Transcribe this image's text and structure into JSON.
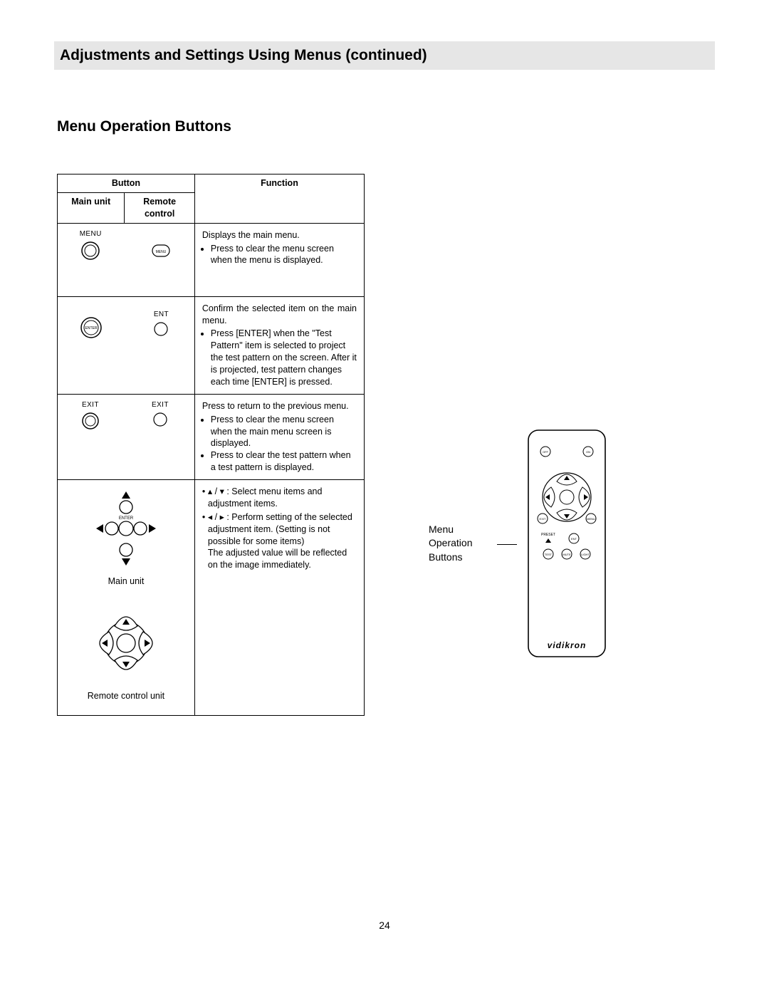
{
  "header": {
    "title": "Adjustments and Settings Using Menus (continued)"
  },
  "section_title": "Menu Operation Buttons",
  "page_number": "24",
  "table": {
    "button_header": "Button",
    "function_header": "Function",
    "main_unit_header": "Main unit",
    "remote_header": "Remote control",
    "rows": [
      {
        "main_label": "MENU",
        "remote_label": "MENU",
        "fn_main": "Displays the main menu.",
        "fn_bullets": [
          "Press to clear the menu screen when the menu is displayed."
        ]
      },
      {
        "main_label": "ENTER",
        "remote_label": "ENT",
        "fn_main": "Confirm the selected item on the main menu.",
        "fn_bullets": [
          "Press [ENTER] when the \"Test Pattern\" item is selected to project the test pattern on the screen. After it is projected, test pattern changes each time [ENTER] is pressed."
        ]
      },
      {
        "main_label": "EXIT",
        "remote_label": "EXIT",
        "fn_main": "Press to return to the previous menu.",
        "fn_bullets": [
          "Press to clear the menu screen when the main menu screen is displayed.",
          "Press to clear the test pattern when a test pattern is displayed."
        ]
      },
      {
        "arrows_label_main": "Main unit",
        "arrows_label_remote": "Remote control unit",
        "enter_label": "ENTER",
        "fn_arrow_ud": "▴ / ▾ : Select menu items and adjustment items.",
        "fn_arrow_lr_line1": "◂ / ▸ : Perform setting of the selected adjustment item. (Setting is not possible for some items)",
        "fn_arrow_lr_line2": "The adjusted value will be reflected on the image immediately."
      }
    ]
  },
  "remote_diagram": {
    "caption_line1": "Menu",
    "caption_line2": "Operation",
    "caption_line3": "Buttons",
    "brand": "vidikron",
    "btn_off": "OFF",
    "btn_on": "ON",
    "btn_exit": "EXIT",
    "btn_menu": "MENU",
    "btn_preset": "PRESET",
    "btn_ent": "ENT",
    "btn_test": "TEST",
    "btn_mute": "MUTE",
    "btn_light": "LIGHT"
  }
}
